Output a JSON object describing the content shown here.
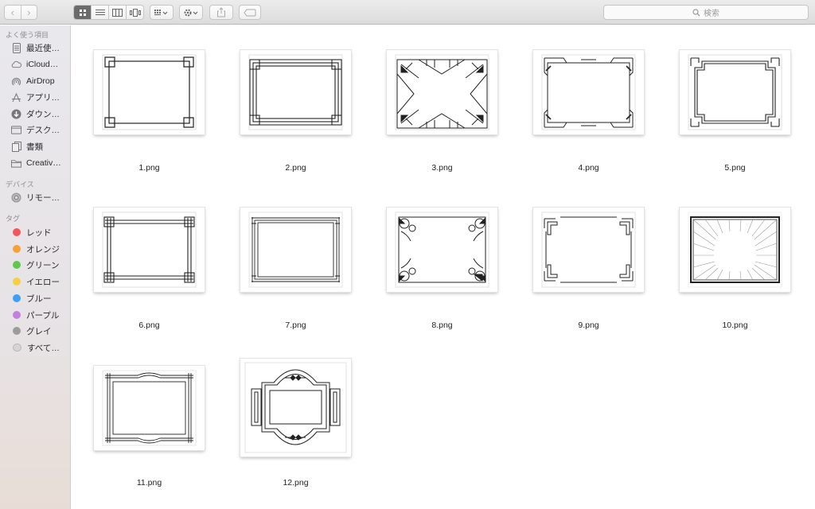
{
  "toolbar": {
    "search_placeholder": "検索",
    "view_modes": [
      "icon-view",
      "list-view",
      "column-view",
      "cover-flow-view"
    ]
  },
  "sidebar": {
    "favorites_heading": "よく使う項目",
    "favorites": [
      {
        "label": "最近使…",
        "icon": "recents-icon"
      },
      {
        "label": "iCloud…",
        "icon": "icloud-icon"
      },
      {
        "label": "AirDrop",
        "icon": "airdrop-icon"
      },
      {
        "label": "アプリ…",
        "icon": "applications-icon"
      },
      {
        "label": "ダウン…",
        "icon": "downloads-icon"
      },
      {
        "label": "デスク…",
        "icon": "desktop-icon"
      },
      {
        "label": "書類",
        "icon": "documents-icon"
      },
      {
        "label": "Creativ…",
        "icon": "folder-icon"
      }
    ],
    "devices_heading": "デバイス",
    "devices": [
      {
        "label": "リモー…",
        "icon": "remote-disc-icon"
      }
    ],
    "tags_heading": "タグ",
    "tags": [
      {
        "label": "レッド",
        "color": "#f4545b"
      },
      {
        "label": "オレンジ",
        "color": "#f6a13a"
      },
      {
        "label": "グリーン",
        "color": "#5fc84a"
      },
      {
        "label": "イエロー",
        "color": "#f7ce46"
      },
      {
        "label": "ブルー",
        "color": "#3e9ff5"
      },
      {
        "label": "パープル",
        "color": "#c580de"
      },
      {
        "label": "グレイ",
        "color": "#9c9c9c"
      },
      {
        "label": "すべて…",
        "color": "#d4d4d4"
      }
    ]
  },
  "files": [
    {
      "name": "1.png"
    },
    {
      "name": "2.png"
    },
    {
      "name": "3.png"
    },
    {
      "name": "4.png"
    },
    {
      "name": "5.png"
    },
    {
      "name": "6.png"
    },
    {
      "name": "7.png"
    },
    {
      "name": "8.png"
    },
    {
      "name": "9.png"
    },
    {
      "name": "10.png"
    },
    {
      "name": "11.png"
    },
    {
      "name": "12.png"
    }
  ]
}
